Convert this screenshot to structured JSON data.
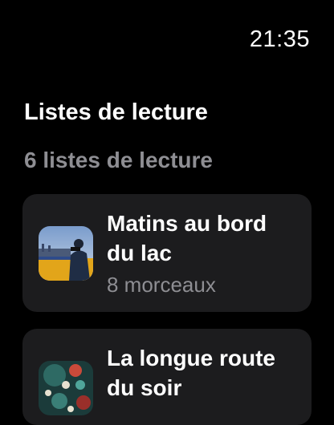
{
  "status_bar": {
    "time": "21:35"
  },
  "header": {
    "title": "Listes de lecture",
    "count_label": "6 listes de lecture"
  },
  "playlists": [
    {
      "title": "Matins au bord du lac",
      "subtitle": "8 morceaux",
      "artwork": "lake-morning-artwork"
    },
    {
      "title": "La longue route du soir",
      "subtitle": "",
      "artwork": "evening-road-artwork"
    }
  ],
  "colors": {
    "background": "#000000",
    "card": "#1c1c1e",
    "secondary_text": "#8e8e93"
  }
}
